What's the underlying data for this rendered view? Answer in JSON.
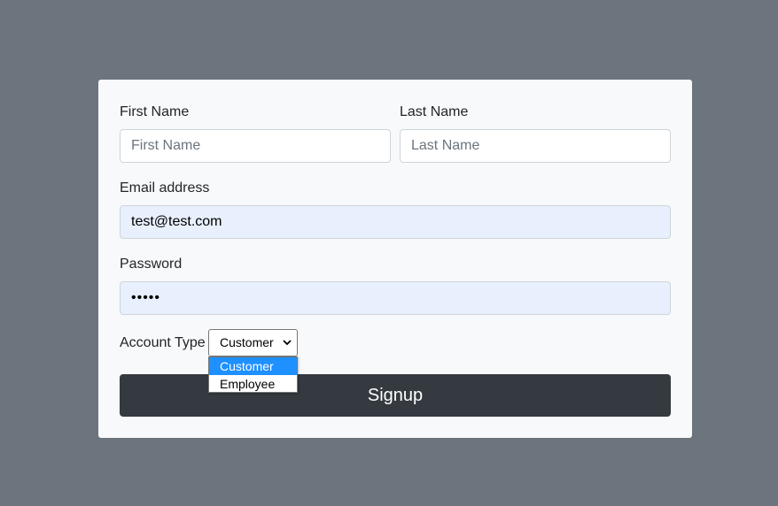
{
  "form": {
    "first_name": {
      "label": "First Name",
      "placeholder": "First Name",
      "value": ""
    },
    "last_name": {
      "label": "Last Name",
      "placeholder": "Last Name",
      "value": ""
    },
    "email": {
      "label": "Email address",
      "value": "test@test.com"
    },
    "password": {
      "label": "Password",
      "masked_value": "•••••"
    },
    "account_type": {
      "label": "Account Type",
      "selected": "Customer",
      "options": [
        "Customer",
        "Employee"
      ]
    },
    "submit_label": "Signup"
  },
  "colors": {
    "page_background": "#6c757d",
    "card_background": "#f8f9fa",
    "autofill_background": "#e8f0fe",
    "button_background": "#343a40",
    "option_highlight": "#1e90ff"
  },
  "icons": {
    "select_arrow": "chevron-down-icon"
  }
}
